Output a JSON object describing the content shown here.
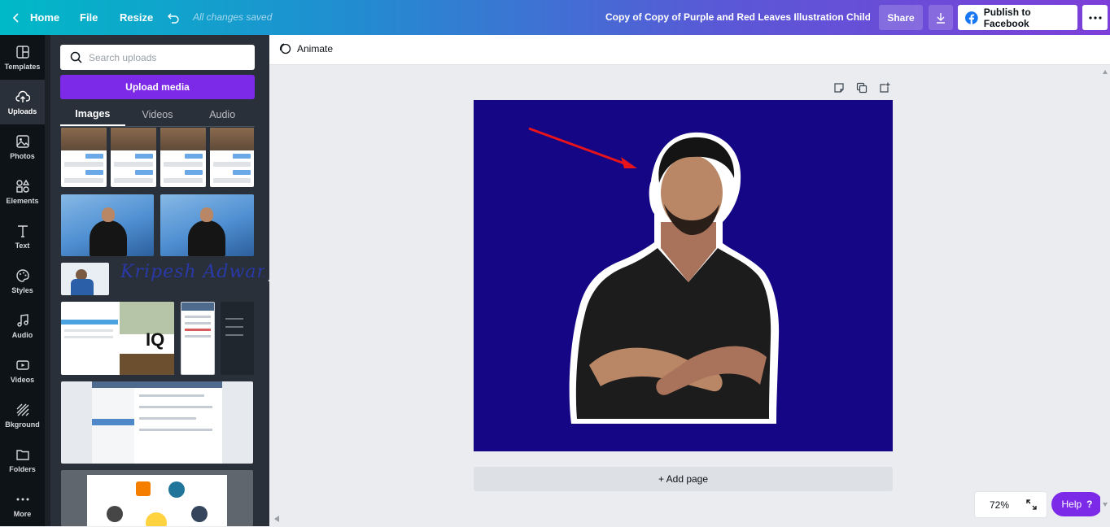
{
  "topbar": {
    "home_label": "Home",
    "file_label": "File",
    "resize_label": "Resize",
    "saved_status": "All changes saved",
    "doc_title": "Copy of Copy of Purple and Red Leaves Illustration Children...",
    "share_label": "Share",
    "publish_label": "Publish to Facebook"
  },
  "rail": {
    "items": [
      {
        "label": "Templates",
        "icon": "templates-icon"
      },
      {
        "label": "Uploads",
        "icon": "upload-cloud-icon"
      },
      {
        "label": "Photos",
        "icon": "image-icon"
      },
      {
        "label": "Elements",
        "icon": "shapes-icon"
      },
      {
        "label": "Text",
        "icon": "text-icon"
      },
      {
        "label": "Styles",
        "icon": "palette-icon"
      },
      {
        "label": "Audio",
        "icon": "music-note-icon"
      },
      {
        "label": "Videos",
        "icon": "video-icon"
      },
      {
        "label": "Bkground",
        "icon": "background-icon"
      },
      {
        "label": "Folders",
        "icon": "folder-icon"
      },
      {
        "label": "More",
        "icon": "more-dots-icon"
      }
    ],
    "active": "Uploads"
  },
  "panel": {
    "search_placeholder": "Search uploads",
    "upload_label": "Upload media",
    "tabs": [
      "Images",
      "Videos",
      "Audio"
    ],
    "active_tab": "Images",
    "signature_text": "Kripesh Adwani",
    "iq_text": "IQ"
  },
  "editor": {
    "animate_label": "Animate",
    "add_page_label": "+ Add page",
    "zoom_level": "72%",
    "help_label": "Help",
    "help_icon": "?"
  },
  "colors": {
    "accent": "#7d2ae8",
    "design_bg": "#140685",
    "arrow": "#e8141c"
  }
}
